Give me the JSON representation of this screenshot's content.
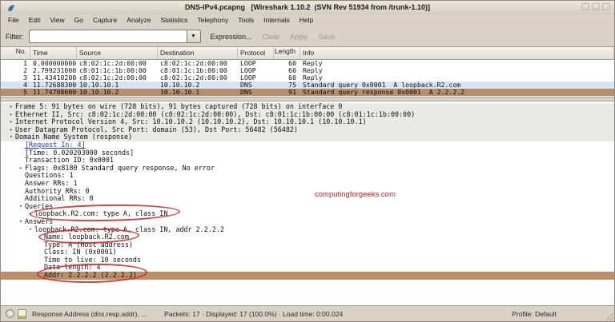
{
  "window": {
    "title": "DNS-IPv4.pcapng   [Wireshark 1.10.2  (SVN Rev 51934 from /trunk-1.10)]"
  },
  "menu": {
    "items": [
      "File",
      "Edit",
      "View",
      "Go",
      "Capture",
      "Analyze",
      "Statistics",
      "Telephony",
      "Tools",
      "Internals",
      "Help"
    ]
  },
  "filter_bar": {
    "label": "Filter:",
    "value": "",
    "expression_label": "Expression...",
    "clear_label": "Clear",
    "apply_label": "Apply",
    "save_label": "Save"
  },
  "packet_list": {
    "columns": [
      "No.",
      "Time",
      "Source",
      "Destination",
      "Protocol",
      "Length",
      "Info"
    ],
    "rows": [
      {
        "no": "1",
        "time": "0.000000000",
        "source": "c8:02:1c:2d:00:00",
        "destination": "c8:02:1c:2d:00:00",
        "protocol": "LOOP",
        "length": "60",
        "info": "Reply",
        "state": "normal"
      },
      {
        "no": "2",
        "time": "2.799231000",
        "source": "c8:01:1c:1b:00:00",
        "destination": "c8:01:1c:1b:00:00",
        "protocol": "LOOP",
        "length": "60",
        "info": "Reply",
        "state": "normal"
      },
      {
        "no": "3",
        "time": "11.434102000",
        "source": "c8:02:1c:2d:00:00",
        "destination": "c8:02:1c:2d:00:00",
        "protocol": "LOOP",
        "length": "60",
        "info": "Reply",
        "state": "normal"
      },
      {
        "no": "4",
        "time": "11.726883000",
        "source": "10.10.10.1",
        "destination": "10.10.10.2",
        "protocol": "DNS",
        "length": "75",
        "info": "Standard query 0x0001  A loopback.R2.com",
        "state": "related"
      },
      {
        "no": "5",
        "time": "11.747086000",
        "source": "10.10.10.2",
        "destination": "10.10.10.1",
        "protocol": "DNS",
        "length": "91",
        "info": "Standard query response 0x0001  A 2.2.2.2",
        "state": "selected"
      }
    ]
  },
  "details": {
    "lines": [
      {
        "indent": 0,
        "expander": "collapsed",
        "text": "Frame 5: 91 bytes on wire (728 bits), 91 bytes captured (728 bits) on interface 0"
      },
      {
        "indent": 0,
        "expander": "collapsed",
        "text": "Ethernet II, Src: c8:02:1c:2d:00:00 (c8:02:1c:2d:00:00), Dst: c8:01:1c:1b:00:00 (c8:01:1c:1b:00:00)"
      },
      {
        "indent": 0,
        "expander": "collapsed",
        "text": "Internet Protocol Version 4, Src: 10.10.10.2 (10.10.10.2), Dst: 10.10.10.1 (10.10.10.1)"
      },
      {
        "indent": 0,
        "expander": "collapsed",
        "text": "User Datagram Protocol, Src Port: domain (53), Dst Port: 56482 (56482)"
      },
      {
        "indent": 0,
        "expander": "expanded",
        "text": "Domain Name System (response)"
      },
      {
        "indent": 1,
        "expander": "none",
        "text": "[Request In: 4]",
        "link": true
      },
      {
        "indent": 1,
        "expander": "none",
        "text": "[Time: 0.020203000 seconds]"
      },
      {
        "indent": 1,
        "expander": "none",
        "text": "Transaction ID: 0x0001"
      },
      {
        "indent": 1,
        "expander": "collapsed",
        "text": "Flags: 0x8180 Standard query response, No error"
      },
      {
        "indent": 1,
        "expander": "none",
        "text": "Questions: 1"
      },
      {
        "indent": 1,
        "expander": "none",
        "text": "Answer RRs: 1"
      },
      {
        "indent": 1,
        "expander": "none",
        "text": "Authority RRs: 0"
      },
      {
        "indent": 1,
        "expander": "none",
        "text": "Additional RRs: 0"
      },
      {
        "indent": 1,
        "expander": "expanded",
        "text": "Queries"
      },
      {
        "indent": 2,
        "expander": "collapsed",
        "text": "loopback.R2.com: type A, class IN"
      },
      {
        "indent": 1,
        "expander": "expanded",
        "text": "Answers"
      },
      {
        "indent": 2,
        "expander": "expanded",
        "text": "loopback.R2.com: type A, class IN, addr 2.2.2.2"
      },
      {
        "indent": 3,
        "expander": "none",
        "text": "Name: loopback.R2.com"
      },
      {
        "indent": 3,
        "expander": "none",
        "text": "Type: A (Host address)"
      },
      {
        "indent": 3,
        "expander": "none",
        "text": "Class: IN (0x0001)"
      },
      {
        "indent": 3,
        "expander": "none",
        "text": "Time to live: 10 seconds"
      },
      {
        "indent": 3,
        "expander": "none",
        "text": "Data length: 4"
      },
      {
        "indent": 3,
        "expander": "none",
        "text": "Addr: 2.2.2.2 (2.2.2.2)",
        "selected": true
      }
    ]
  },
  "annotations": {
    "watermark": "computingforgeeks.com",
    "circled_fields": [
      "loopback.R2.com: type A, class IN",
      "Name: loopback.R2.com",
      "Addr: 2.2.2.2 (2.2.2.2)"
    ],
    "annotation_color": "#cf2828"
  },
  "status_bar": {
    "field_hint": "Response Address (dns.resp.addr), ...",
    "counts": "Packets: 17 · Displayed: 17 (100.0%) · Load time: 0:00.024",
    "profile": "Profile: Default"
  },
  "colors": {
    "chrome": "#d8d3c6",
    "selected_row": "#b78f6a",
    "related_row": "#d6e5f5",
    "band": "#e9e9e8",
    "link": "#1b3ccc"
  }
}
